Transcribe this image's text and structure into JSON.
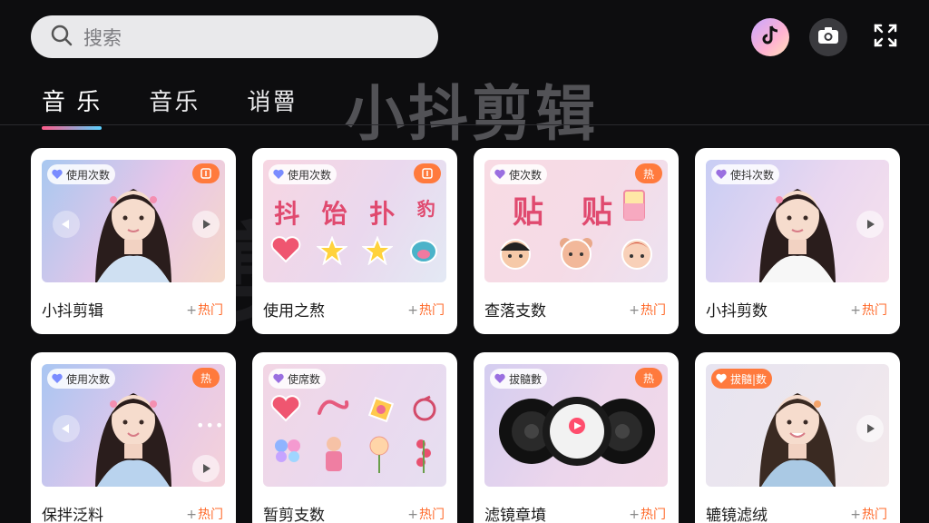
{
  "search": {
    "placeholder": "搜索"
  },
  "watermark": "小抖剪辑",
  "tabs": [
    {
      "label": "音 乐"
    },
    {
      "label": "音乐"
    },
    {
      "label": "诮罾"
    }
  ],
  "cards": [
    {
      "badge": "使用次数",
      "corner": "",
      "title": "小抖剪辑",
      "tag": "热门"
    },
    {
      "badge": "使用次数",
      "corner": "",
      "title": "使用之熬",
      "tag": "热门",
      "stickers": [
        "抖",
        "饴",
        "扑",
        "豹"
      ]
    },
    {
      "badge": "使次数",
      "corner": "热",
      "title": "查落支数",
      "tag": "热门",
      "stickers": [
        "贴",
        "贴"
      ]
    },
    {
      "badge": "使抖次数",
      "corner": "",
      "title": "小抖剪数",
      "tag": "热门"
    },
    {
      "badge": "使用次数",
      "corner": "热",
      "title": "保拌泛料",
      "tag": "热门"
    },
    {
      "badge": "使席数",
      "corner": "",
      "title": "暂剪支数",
      "tag": "热门"
    },
    {
      "badge": "拔髓數",
      "corner": "热",
      "title": "滤镜章墳",
      "tag": "热门"
    },
    {
      "badge": "拔髓|数",
      "corner": "",
      "title": "辘镜滤绒",
      "tag": "热门"
    }
  ],
  "colors": {
    "accent": "#ff6a2a",
    "background": "#0d0d0f",
    "card": "#ffffff"
  },
  "icons": [
    "search-icon",
    "tiktok-logo-icon",
    "camera-icon",
    "expand-icon",
    "play-icon",
    "heart-icon"
  ]
}
